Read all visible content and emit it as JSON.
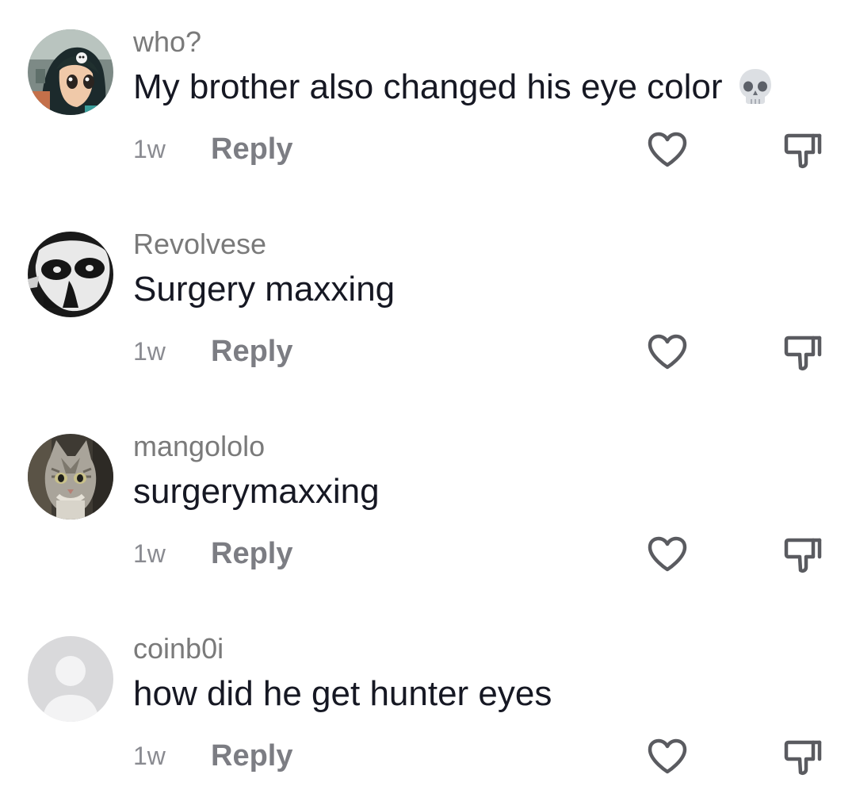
{
  "comments": [
    {
      "username": "who?",
      "text": "My brother also changed his eye color",
      "emoji": "skull",
      "time": "1w",
      "reply_label": "Reply"
    },
    {
      "username": "Revolvese",
      "text": "Surgery maxxing",
      "time": "1w",
      "reply_label": "Reply"
    },
    {
      "username": "mangololo",
      "text": "surgerymaxxing",
      "time": "1w",
      "reply_label": "Reply"
    },
    {
      "username": "coinb0i",
      "text": "how did he get hunter eyes",
      "time": "1w",
      "reply_label": "Reply"
    }
  ],
  "icons": {
    "like": "heart-outline-icon",
    "dislike": "thumbs-down-outline-icon",
    "emoji": "skull-icon"
  },
  "colors": {
    "username": "#7a7a7a",
    "comment_text": "#161823",
    "meta_text": "#8a8b91",
    "icon_stroke": "#5a5b60"
  }
}
